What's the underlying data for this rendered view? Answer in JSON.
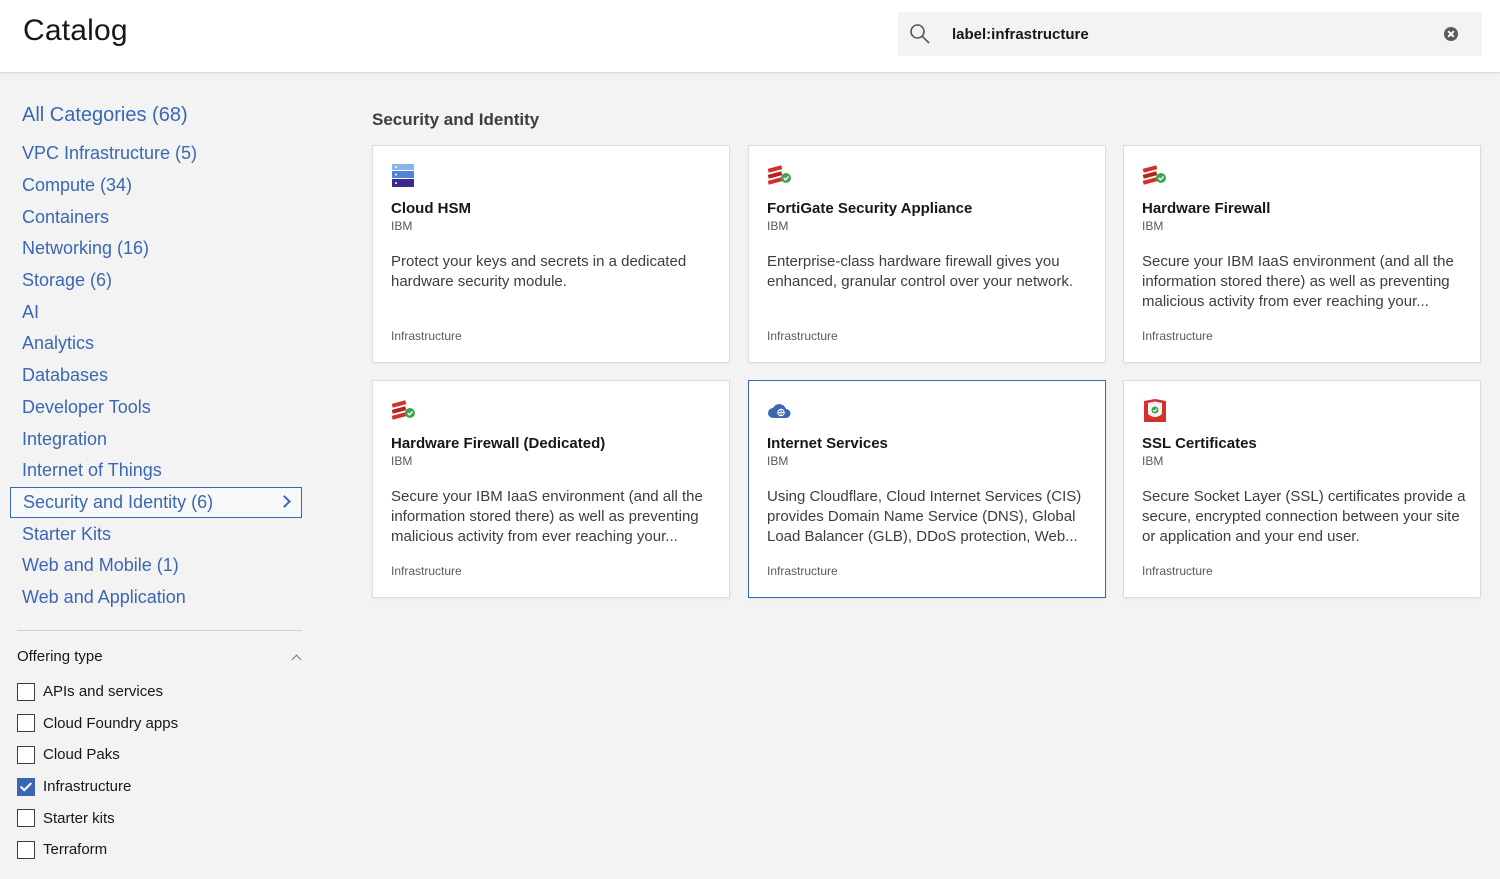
{
  "header": {
    "title": "Catalog",
    "search_value": "label:infrastructure"
  },
  "sidebar": {
    "all_label": "All Categories (68)",
    "categories": [
      {
        "label": "VPC Infrastructure (5)"
      },
      {
        "label": "Compute (34)"
      },
      {
        "label": "Containers"
      },
      {
        "label": "Networking (16)"
      },
      {
        "label": "Storage (6)"
      },
      {
        "label": "AI"
      },
      {
        "label": "Analytics"
      },
      {
        "label": "Databases"
      },
      {
        "label": "Developer Tools"
      },
      {
        "label": "Integration"
      },
      {
        "label": "Internet of Things"
      },
      {
        "label": "Security and Identity (6)",
        "active": true
      },
      {
        "label": "Starter Kits"
      },
      {
        "label": "Web and Mobile (1)"
      },
      {
        "label": "Web and Application"
      }
    ],
    "filter_title": "Offering type",
    "filters": [
      {
        "label": "APIs and services",
        "checked": false
      },
      {
        "label": "Cloud Foundry apps",
        "checked": false
      },
      {
        "label": "Cloud Paks",
        "checked": false
      },
      {
        "label": "Infrastructure",
        "checked": true
      },
      {
        "label": "Starter kits",
        "checked": false
      },
      {
        "label": "Terraform",
        "checked": false
      }
    ]
  },
  "main": {
    "section_title": "Security and Identity",
    "cards": [
      {
        "title": "Cloud HSM",
        "vendor": "IBM",
        "description": "Protect your keys and secrets in a dedicated hardware security module.",
        "tag": "Infrastructure",
        "icon": "hsm-icon"
      },
      {
        "title": "FortiGate Security Appliance",
        "vendor": "IBM",
        "description": "Enterprise-class hardware firewall gives you enhanced, granular control over your network.",
        "tag": "Infrastructure",
        "icon": "firewall-icon"
      },
      {
        "title": "Hardware Firewall",
        "vendor": "IBM",
        "description": "Secure your IBM IaaS environment (and all the information stored there) as well as preventing malicious activity from ever reaching your...",
        "tag": "Infrastructure",
        "icon": "firewall-icon"
      },
      {
        "title": "Hardware Firewall (Dedicated)",
        "vendor": "IBM",
        "description": "Secure your IBM IaaS environment (and all the information stored there) as well as preventing malicious activity from ever reaching your...",
        "tag": "Infrastructure",
        "icon": "firewall-icon"
      },
      {
        "title": "Internet Services",
        "vendor": "IBM",
        "description": "Using Cloudflare, Cloud Internet Services (CIS) provides Domain Name Service (DNS), Global Load Balancer (GLB), DDoS protection, Web...",
        "tag": "Infrastructure",
        "icon": "cloud-icon"
      },
      {
        "title": "SSL Certificates",
        "vendor": "IBM",
        "description": "Secure Socket Layer (SSL) certificates provide a secure, encrypted connection between your site or application and your end user.",
        "tag": "Infrastructure",
        "icon": "shield-icon"
      }
    ]
  },
  "colors": {
    "link": "#3b67b2",
    "background": "#f3f3f3",
    "firewall_red": "#d0322e",
    "check_green": "#3ea653"
  }
}
